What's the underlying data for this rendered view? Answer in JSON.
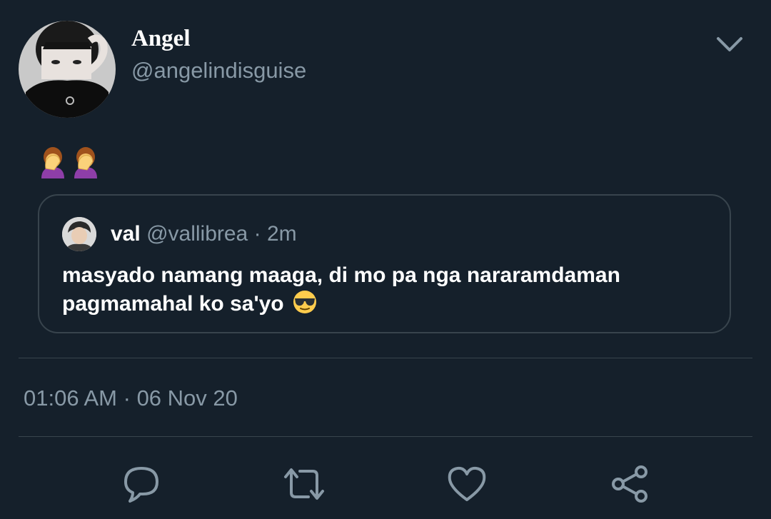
{
  "tweet": {
    "display_name": "Angel",
    "handle": "@angelindisguise",
    "emojis": [
      "🤦‍♀️",
      "🤦‍♀️"
    ],
    "quoted": {
      "name": "val",
      "handle": "@vallibrea",
      "separator": "·",
      "time": "2m",
      "text_line1": "masyado namang maaga, di mo pa nga nararamdaman",
      "text_line2": "pagmamahal ko sa'yo",
      "emoji": "😎"
    },
    "time": "01:06 AM",
    "separator": "·",
    "date": "06 Nov 20"
  },
  "icons": {
    "menu": "chevron-down-icon",
    "reply": "reply-icon",
    "retweet": "retweet-icon",
    "like": "heart-icon",
    "share": "share-icon"
  },
  "colors": {
    "background": "#15202b",
    "secondary_text": "#8899a6",
    "border": "#38444d"
  }
}
